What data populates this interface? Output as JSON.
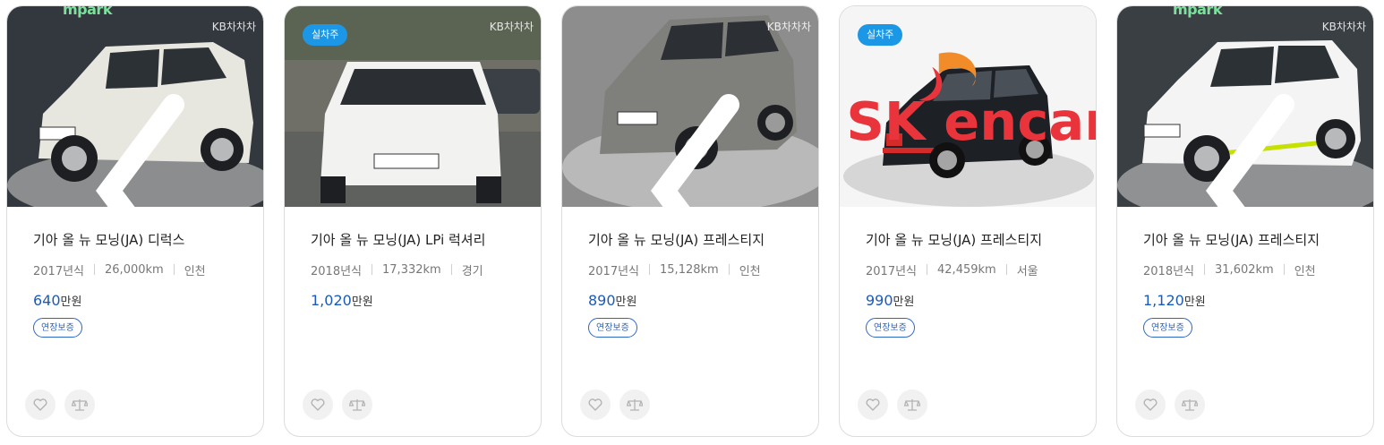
{
  "cards": [
    {
      "badge": "",
      "watermark_left": "mpark",
      "watermark_right": "KB차차차",
      "bg": "#34393f",
      "car_color": "#e7e6df",
      "title": "기아 올 뉴 모닝(JA) 디럭스",
      "year": "2017년식",
      "mileage": "26,000km",
      "region": "인천",
      "price": "640",
      "price_unit": "만원",
      "tag": "연장보증"
    },
    {
      "badge": "실차주",
      "watermark_left": "",
      "watermark_right": "KB차차차",
      "bg": "#6e6e66",
      "car_color": "#f2f2f0",
      "title": "기아 올 뉴 모닝(JA) LPi 럭셔리",
      "year": "2018년식",
      "mileage": "17,332km",
      "region": "경기",
      "price": "1,020",
      "price_unit": "만원",
      "tag": ""
    },
    {
      "badge": "",
      "watermark_left": "",
      "watermark_right": "KB차차차",
      "bg": "#8a8a8a",
      "car_color": "#7f7f7c",
      "title": "기아 올 뉴 모닝(JA) 프레스티지",
      "year": "2017년식",
      "mileage": "15,128km",
      "region": "인천",
      "price": "890",
      "price_unit": "만원",
      "tag": "연장보증"
    },
    {
      "badge": "실차주",
      "watermark_left": "",
      "watermark_right": "",
      "sk_logo": "SK encar",
      "bg": "#f4f4f4",
      "car_color": "#1d2025",
      "title": "기아 올 뉴 모닝(JA) 프레스티지",
      "year": "2017년식",
      "mileage": "42,459km",
      "region": "서울",
      "price": "990",
      "price_unit": "만원",
      "tag": "연장보증"
    },
    {
      "badge": "",
      "watermark_left": "mpark",
      "watermark_right": "KB차차차",
      "bg": "#3a3f44",
      "car_color": "#f4f4f4",
      "title": "기아 올 뉴 모닝(JA) 프레스티지",
      "year": "2018년식",
      "mileage": "31,602km",
      "region": "인천",
      "price": "1,120",
      "price_unit": "만원",
      "tag": "연장보증"
    }
  ],
  "icons": {
    "prev": "chevron-left-icon",
    "next": "chevron-right-icon",
    "like": "heart-icon",
    "compare": "scale-icon"
  },
  "colors": {
    "price": "#1a5bb9",
    "badge": "#1b97e6",
    "tag": "#2c67c4"
  }
}
